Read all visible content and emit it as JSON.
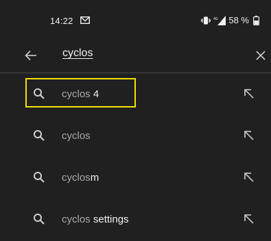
{
  "status_bar": {
    "time": "14:22",
    "battery": "58 %",
    "network": "4G",
    "icons": [
      "gmail-icon",
      "vibrate-icon",
      "signal-icon",
      "battery-icon"
    ]
  },
  "search": {
    "query": "cyclos",
    "back_icon": "arrow-left-icon",
    "clear_icon": "close-icon"
  },
  "suggestions": [
    {
      "prefix": "cyclos",
      "completion": " 4",
      "icon": "search-icon",
      "action_icon": "arrow-up-left-icon",
      "highlighted": true
    },
    {
      "prefix": "cyclos",
      "completion": "",
      "icon": "search-icon",
      "action_icon": "arrow-up-left-icon",
      "highlighted": false
    },
    {
      "prefix": "cyclos",
      "completion": "m",
      "icon": "search-icon",
      "action_icon": "arrow-up-left-icon",
      "highlighted": false
    },
    {
      "prefix": "cyclos",
      "completion": " settings",
      "icon": "search-icon",
      "action_icon": "arrow-up-left-icon",
      "highlighted": false
    }
  ],
  "colors": {
    "background": "#202020",
    "highlight": "#f5e300",
    "muted_text": "#a9a9a9",
    "bright_text": "#f2f2f2"
  }
}
